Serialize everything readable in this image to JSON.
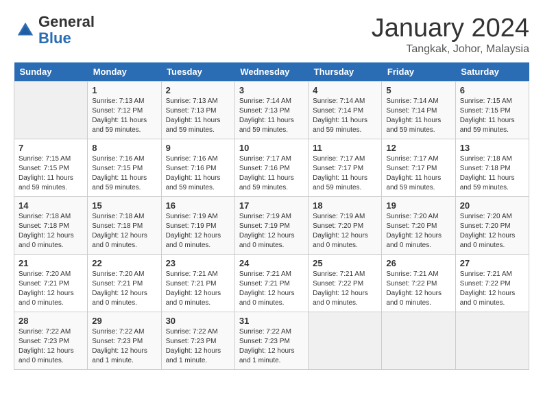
{
  "header": {
    "logo_line1": "General",
    "logo_line2": "Blue",
    "month": "January 2024",
    "location": "Tangkak, Johor, Malaysia"
  },
  "days_of_week": [
    "Sunday",
    "Monday",
    "Tuesday",
    "Wednesday",
    "Thursday",
    "Friday",
    "Saturday"
  ],
  "weeks": [
    [
      {
        "day": "",
        "sunrise": "",
        "sunset": "",
        "daylight": ""
      },
      {
        "day": "1",
        "sunrise": "Sunrise: 7:13 AM",
        "sunset": "Sunset: 7:12 PM",
        "daylight": "Daylight: 11 hours and 59 minutes."
      },
      {
        "day": "2",
        "sunrise": "Sunrise: 7:13 AM",
        "sunset": "Sunset: 7:13 PM",
        "daylight": "Daylight: 11 hours and 59 minutes."
      },
      {
        "day": "3",
        "sunrise": "Sunrise: 7:14 AM",
        "sunset": "Sunset: 7:13 PM",
        "daylight": "Daylight: 11 hours and 59 minutes."
      },
      {
        "day": "4",
        "sunrise": "Sunrise: 7:14 AM",
        "sunset": "Sunset: 7:14 PM",
        "daylight": "Daylight: 11 hours and 59 minutes."
      },
      {
        "day": "5",
        "sunrise": "Sunrise: 7:14 AM",
        "sunset": "Sunset: 7:14 PM",
        "daylight": "Daylight: 11 hours and 59 minutes."
      },
      {
        "day": "6",
        "sunrise": "Sunrise: 7:15 AM",
        "sunset": "Sunset: 7:15 PM",
        "daylight": "Daylight: 11 hours and 59 minutes."
      }
    ],
    [
      {
        "day": "7",
        "sunrise": "Sunrise: 7:15 AM",
        "sunset": "Sunset: 7:15 PM",
        "daylight": "Daylight: 11 hours and 59 minutes."
      },
      {
        "day": "8",
        "sunrise": "Sunrise: 7:16 AM",
        "sunset": "Sunset: 7:15 PM",
        "daylight": "Daylight: 11 hours and 59 minutes."
      },
      {
        "day": "9",
        "sunrise": "Sunrise: 7:16 AM",
        "sunset": "Sunset: 7:16 PM",
        "daylight": "Daylight: 11 hours and 59 minutes."
      },
      {
        "day": "10",
        "sunrise": "Sunrise: 7:17 AM",
        "sunset": "Sunset: 7:16 PM",
        "daylight": "Daylight: 11 hours and 59 minutes."
      },
      {
        "day": "11",
        "sunrise": "Sunrise: 7:17 AM",
        "sunset": "Sunset: 7:17 PM",
        "daylight": "Daylight: 11 hours and 59 minutes."
      },
      {
        "day": "12",
        "sunrise": "Sunrise: 7:17 AM",
        "sunset": "Sunset: 7:17 PM",
        "daylight": "Daylight: 11 hours and 59 minutes."
      },
      {
        "day": "13",
        "sunrise": "Sunrise: 7:18 AM",
        "sunset": "Sunset: 7:18 PM",
        "daylight": "Daylight: 11 hours and 59 minutes."
      }
    ],
    [
      {
        "day": "14",
        "sunrise": "Sunrise: 7:18 AM",
        "sunset": "Sunset: 7:18 PM",
        "daylight": "Daylight: 12 hours and 0 minutes."
      },
      {
        "day": "15",
        "sunrise": "Sunrise: 7:18 AM",
        "sunset": "Sunset: 7:18 PM",
        "daylight": "Daylight: 12 hours and 0 minutes."
      },
      {
        "day": "16",
        "sunrise": "Sunrise: 7:19 AM",
        "sunset": "Sunset: 7:19 PM",
        "daylight": "Daylight: 12 hours and 0 minutes."
      },
      {
        "day": "17",
        "sunrise": "Sunrise: 7:19 AM",
        "sunset": "Sunset: 7:19 PM",
        "daylight": "Daylight: 12 hours and 0 minutes."
      },
      {
        "day": "18",
        "sunrise": "Sunrise: 7:19 AM",
        "sunset": "Sunset: 7:20 PM",
        "daylight": "Daylight: 12 hours and 0 minutes."
      },
      {
        "day": "19",
        "sunrise": "Sunrise: 7:20 AM",
        "sunset": "Sunset: 7:20 PM",
        "daylight": "Daylight: 12 hours and 0 minutes."
      },
      {
        "day": "20",
        "sunrise": "Sunrise: 7:20 AM",
        "sunset": "Sunset: 7:20 PM",
        "daylight": "Daylight: 12 hours and 0 minutes."
      }
    ],
    [
      {
        "day": "21",
        "sunrise": "Sunrise: 7:20 AM",
        "sunset": "Sunset: 7:21 PM",
        "daylight": "Daylight: 12 hours and 0 minutes."
      },
      {
        "day": "22",
        "sunrise": "Sunrise: 7:20 AM",
        "sunset": "Sunset: 7:21 PM",
        "daylight": "Daylight: 12 hours and 0 minutes."
      },
      {
        "day": "23",
        "sunrise": "Sunrise: 7:21 AM",
        "sunset": "Sunset: 7:21 PM",
        "daylight": "Daylight: 12 hours and 0 minutes."
      },
      {
        "day": "24",
        "sunrise": "Sunrise: 7:21 AM",
        "sunset": "Sunset: 7:21 PM",
        "daylight": "Daylight: 12 hours and 0 minutes."
      },
      {
        "day": "25",
        "sunrise": "Sunrise: 7:21 AM",
        "sunset": "Sunset: 7:22 PM",
        "daylight": "Daylight: 12 hours and 0 minutes."
      },
      {
        "day": "26",
        "sunrise": "Sunrise: 7:21 AM",
        "sunset": "Sunset: 7:22 PM",
        "daylight": "Daylight: 12 hours and 0 minutes."
      },
      {
        "day": "27",
        "sunrise": "Sunrise: 7:21 AM",
        "sunset": "Sunset: 7:22 PM",
        "daylight": "Daylight: 12 hours and 0 minutes."
      }
    ],
    [
      {
        "day": "28",
        "sunrise": "Sunrise: 7:22 AM",
        "sunset": "Sunset: 7:23 PM",
        "daylight": "Daylight: 12 hours and 0 minutes."
      },
      {
        "day": "29",
        "sunrise": "Sunrise: 7:22 AM",
        "sunset": "Sunset: 7:23 PM",
        "daylight": "Daylight: 12 hours and 1 minute."
      },
      {
        "day": "30",
        "sunrise": "Sunrise: 7:22 AM",
        "sunset": "Sunset: 7:23 PM",
        "daylight": "Daylight: 12 hours and 1 minute."
      },
      {
        "day": "31",
        "sunrise": "Sunrise: 7:22 AM",
        "sunset": "Sunset: 7:23 PM",
        "daylight": "Daylight: 12 hours and 1 minute."
      },
      {
        "day": "",
        "sunrise": "",
        "sunset": "",
        "daylight": ""
      },
      {
        "day": "",
        "sunrise": "",
        "sunset": "",
        "daylight": ""
      },
      {
        "day": "",
        "sunrise": "",
        "sunset": "",
        "daylight": ""
      }
    ]
  ]
}
